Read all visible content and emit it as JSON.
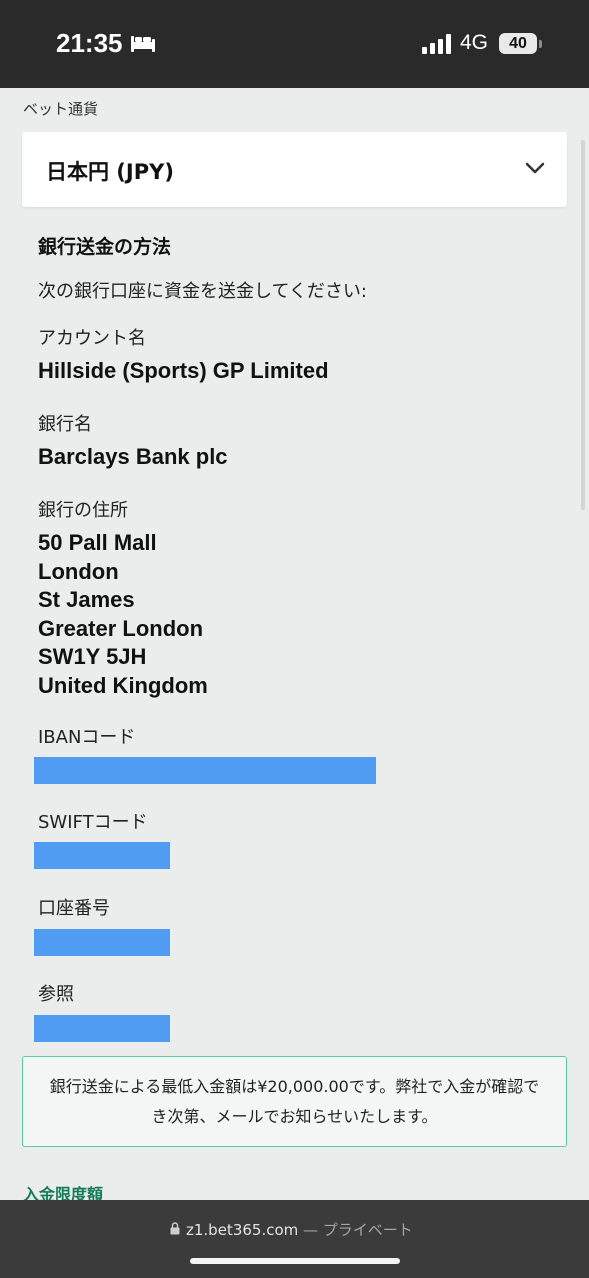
{
  "status_bar": {
    "time": "21:35",
    "network": "4G",
    "battery": "40"
  },
  "currency": {
    "label": "ベット通貨",
    "selected": "日本円 (JPY)"
  },
  "bank_transfer": {
    "title": "銀行送金の方法",
    "instruction": "次の銀行口座に資金を送金してください:",
    "account_name_label": "アカウント名",
    "account_name": "Hillside (Sports) GP Limited",
    "bank_name_label": "銀行名",
    "bank_name": "Barclays Bank plc",
    "bank_address_label": "銀行の住所",
    "bank_address_lines": [
      "50 Pall Mall",
      "London",
      "St James",
      "Greater London",
      "SW1Y 5JH",
      "United Kingdom"
    ],
    "iban_label": "IBANコード",
    "swift_label": "SWIFTコード",
    "account_number_label": "口座番号",
    "reference_label": "参照"
  },
  "notice": {
    "text": "銀行送金による最低入金額は¥20,000.00です。弊社で入金が確認でき次第、メールでお知らせいたします。"
  },
  "deposit_limits_link": "入金限度額",
  "browser": {
    "url": "z1.bet365.com",
    "mode": " — プライベート"
  },
  "colors": {
    "accent_green": "#127b58",
    "notice_border": "#5dc9a0",
    "redaction": "#4f9cf2"
  }
}
